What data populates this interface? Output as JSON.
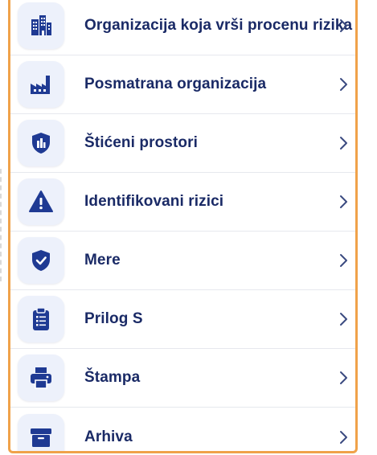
{
  "menu": {
    "items": [
      {
        "label": "Organizacija koja vrši procenu rizika",
        "icon": "building-icon"
      },
      {
        "label": "Posmatrana organizacija",
        "icon": "factory-icon"
      },
      {
        "label": "Štićeni prostori",
        "icon": "shield-building-icon"
      },
      {
        "label": "Identifikovani rizici",
        "icon": "warning-icon"
      },
      {
        "label": "Mere",
        "icon": "shield-check-icon"
      },
      {
        "label": "Prilog S",
        "icon": "clipboard-list-icon"
      },
      {
        "label": "Štampa",
        "icon": "printer-icon"
      },
      {
        "label": "Arhiva",
        "icon": "archive-box-icon"
      }
    ]
  },
  "colors": {
    "icon": "#1f3a93",
    "text": "#1a2a66",
    "frame": "#f0a24a",
    "tile": "#edf1fb",
    "chevron": "#3a4a80"
  }
}
